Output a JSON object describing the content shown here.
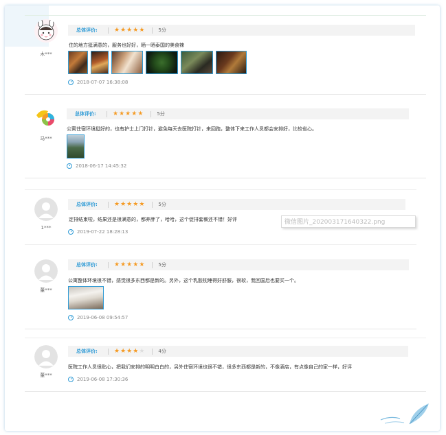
{
  "labels": {
    "overall_rating": "总体评价:"
  },
  "watermark": "微信图片_20200317164032​2.png",
  "reviews": [
    {
      "user": "木***",
      "stars": 5,
      "score": "5分",
      "comment": "住的地方挺满意的，服务也好好，晒一晒泰国的美食辣",
      "time": "2018-07-07 16:38:08",
      "photos": 6
    },
    {
      "user": "马***",
      "stars": 5,
      "score": "5分",
      "comment": "公寓住宿环境挺好的，也有护士上门打针，避免每天去医院打针，来回跑，整体下来工作人员都会安排好，比较省心。",
      "time": "2018-06-17 14:45:32",
      "photos": 1
    },
    {
      "user": "1***",
      "stars": 5,
      "score": "5分",
      "comment": "定排结束啦，结果还是很满意的，都养胖了，哈哈，这个促排套餐还不错！好评",
      "time": "2019-07-22 18:28:13",
      "photos": 0
    },
    {
      "user": "董***",
      "stars": 5,
      "score": "5分",
      "comment": "公寓整体环境很不错，感觉很多东西都是新的。另外，这个乳胶枕睡得好舒服，很软，我回国后也要买一个。",
      "time": "2019-06-08 09:54:57",
      "photos": 1
    },
    {
      "user": "董***",
      "stars": 4,
      "score": "4分",
      "comment": "医院工作人员很贴心，把我们安排的明明白白的，另外住宿环境也很不错，很多东西都是新的，不像酒店，有点像自己的家一样，好评",
      "time": "2019-06-08 17:30:36",
      "photos": 0
    }
  ],
  "colors": {
    "accent": "#2f9bd6",
    "star": "#f59a23",
    "bar_bg": "#f3f3f3"
  }
}
